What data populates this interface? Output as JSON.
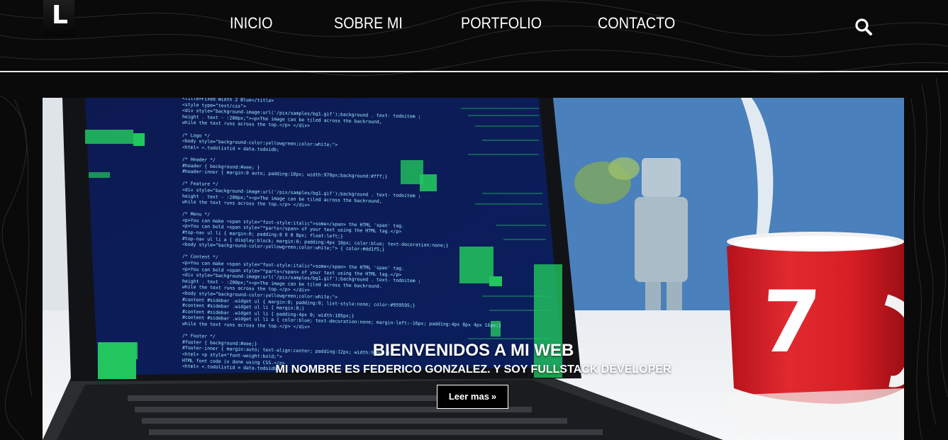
{
  "header": {
    "logo_letter": "L",
    "nav": [
      {
        "label": "INICIO"
      },
      {
        "label": "SOBRE MI"
      },
      {
        "label": "PORTFOLIO"
      },
      {
        "label": "CONTACTO"
      }
    ],
    "search_icon": "search-icon"
  },
  "hero": {
    "title": "BIENVENIDOS A MI WEB",
    "subtitle": "MI NOMBRE ES FEDERICO GONZALEZ. Y SOY FULLSTACK DEVELOPER",
    "cta_label": "Leer mas",
    "cta_icon": "double-chevron-right-icon",
    "mug_number": "7",
    "code_lines": [
      "<title>Fixed Width 2 Blue</title>",
      "<style type=\"text/css\">",
      "  <div style=\"background-image:url('/pix/samples/bg1.gif');background . text- todoitem ;",
      "  height . text - :200px;\"><p>The image can be tiled across the backround,",
      "  while the text runs across the top.</p> </div>",
      "",
      "  /* Logo */",
      "  <body style=\"background-color:yellowgreen;color:white;\">",
      "  <html> <.todolistid = data.todoidb;",
      "",
      "  /* Header */",
      "  #header { background:#eee; }",
      "  #header-inner { margin:0 auto; padding:10px; width:970px;background:#fff;}",
      "",
      "  /* Feature */",
      "  <div style=\"background-image:url('/pix/samples/bg1.gif');background . text- todoitem ;",
      "  height . text - :200px;\"><p>The image can be tiled across the backround,",
      "  while the text runs across the top.</p> </div>",
      "",
      "  /* Menu */",
      "  <p>You can make <span style=\"font-style:italic\">some</span> the HTML 'span' tag.",
      "  <p>You can bold <span style=\"*parts</span> of your text using the HTML tag.</p>",
      "  #top-nav ul li { margin:0; padding:8 0 0 8px; float:left;}",
      "  #top-nav ul li a { display:block; margin:0; padding:4px 10px; color:blue; text-decoration:none;}",
      "  <body style=\"background-color:yellowgreen;color:white;\"> { color:#dd1f5;}",
      "",
      "  /* Content */",
      "  <p>You can make <span style=\"font-style:italic\">some</span> the HTML 'span' tag.",
      "  <p>You can bold <span style=\"*parts</span> of your text using the HTML tag.</p>",
      "  <div style=\"background-image:url('/pix/samples/bg1.gif');background . text- todoitem ;",
      "  height . text - :200px;\"><p>The image can be tiled across the backround.",
      "  while the text runs across the top.</p> </div>",
      "  <body style=\"background-color:yellowgreen;color:white;\">",
      "  #content #sidebar .widget ul { margin:0; padding:0; list-style:none; color:#959595;}",
      "  #content #sidebar .widget ul li { margin:0;}",
      "  #content #sidebar .widget ul li { padding:4px 0; width:185px;}",
      "  #content #sidebar .widget ul li a { color:blue; text-decoration:none; margin-left:-16px; padding:4px 8px 4px 16px;}",
      "  while the text runs across the top.</p> </div>",
      "",
      "  /* Footer */",
      "  #footer { background:#eee;}",
      "  #footer-inner { margin:auto; text-align:center; padding:12px; width:970px;}",
      "  <html> <p style=\"font-weight:bold;\">",
      "  HTML font code is done using CSS.</p>",
      "  <html> <.todolistid = data.todoidb;"
    ]
  },
  "colors": {
    "header_bg": "#0a0a0a",
    "divider": "#e8e8e8",
    "screen_bg": "#0d1b4d",
    "code_green": "#22c55e",
    "mug_red": "#d91f26",
    "wall_blue": "#3f78b7"
  }
}
